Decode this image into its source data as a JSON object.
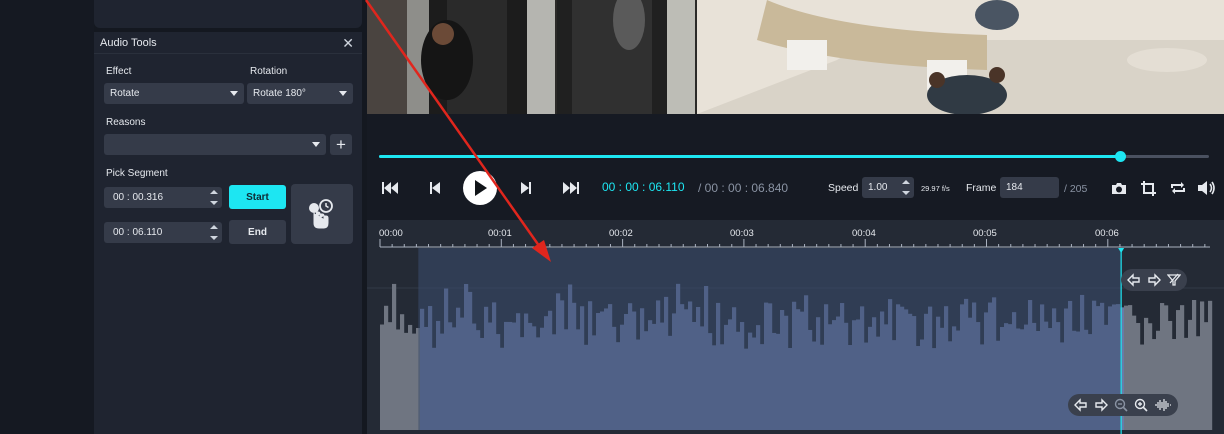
{
  "audio_tools": {
    "title": "Audio Tools",
    "close_glyph": "✕",
    "effect_label": "Effect",
    "effect_value": "Rotate",
    "rotation_label": "Rotation",
    "rotation_value": "Rotate 180°",
    "reasons_label": "Reasons",
    "reasons_value": "",
    "plus_glyph": "+",
    "pick_segment_label": "Pick Segment",
    "start_time": "00 : 00.316",
    "end_time": "00 : 06.110",
    "start_label": "Start",
    "end_label": "End"
  },
  "player": {
    "current_time": "00 : 00 : 06.110",
    "total_time": "/ 00 : 00 : 06.840",
    "progress_fraction": 0.893,
    "speed_label": "Speed",
    "speed_value": "1.00",
    "fps": "29.97 f/s",
    "frame_label": "Frame",
    "frame_value": "184",
    "frame_total": "/ 205"
  },
  "timeline": {
    "ticks": [
      "00:00",
      "00:01",
      "00:02",
      "00:03",
      "00:04",
      "00:05",
      "00:06"
    ],
    "selection_start_sec": 0.316,
    "selection_end_sec": 6.11
  },
  "colors": {
    "accent": "#1de6f2",
    "panel": "#1f2430",
    "field": "#353b49",
    "selection": "#3b4d6e",
    "annotation_arrow": "#e0261d"
  }
}
